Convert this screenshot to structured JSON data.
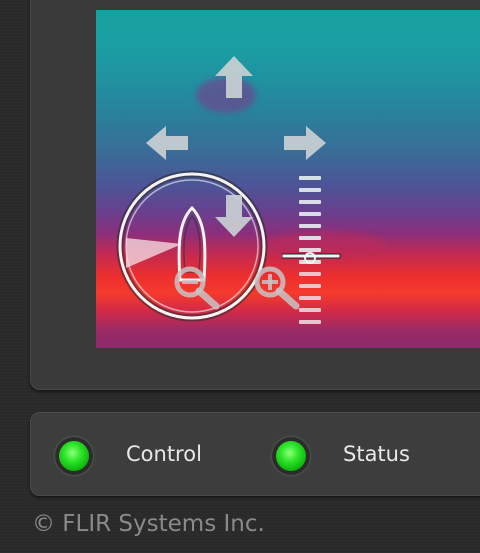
{
  "status_panel": {
    "indicators": [
      {
        "label": "Control",
        "color": "#22dd22"
      },
      {
        "label": "Status",
        "color": "#22dd22"
      }
    ]
  },
  "footer": {
    "copyright": "© FLIR Systems Inc."
  },
  "overlay_icons": [
    "pan-up-arrow-icon",
    "pan-left-arrow-icon",
    "pan-right-arrow-icon",
    "pan-down-arrow-icon",
    "vessel-heading-compass-icon",
    "zoom-out-icon",
    "zoom-in-icon",
    "zoom-level-scale"
  ]
}
